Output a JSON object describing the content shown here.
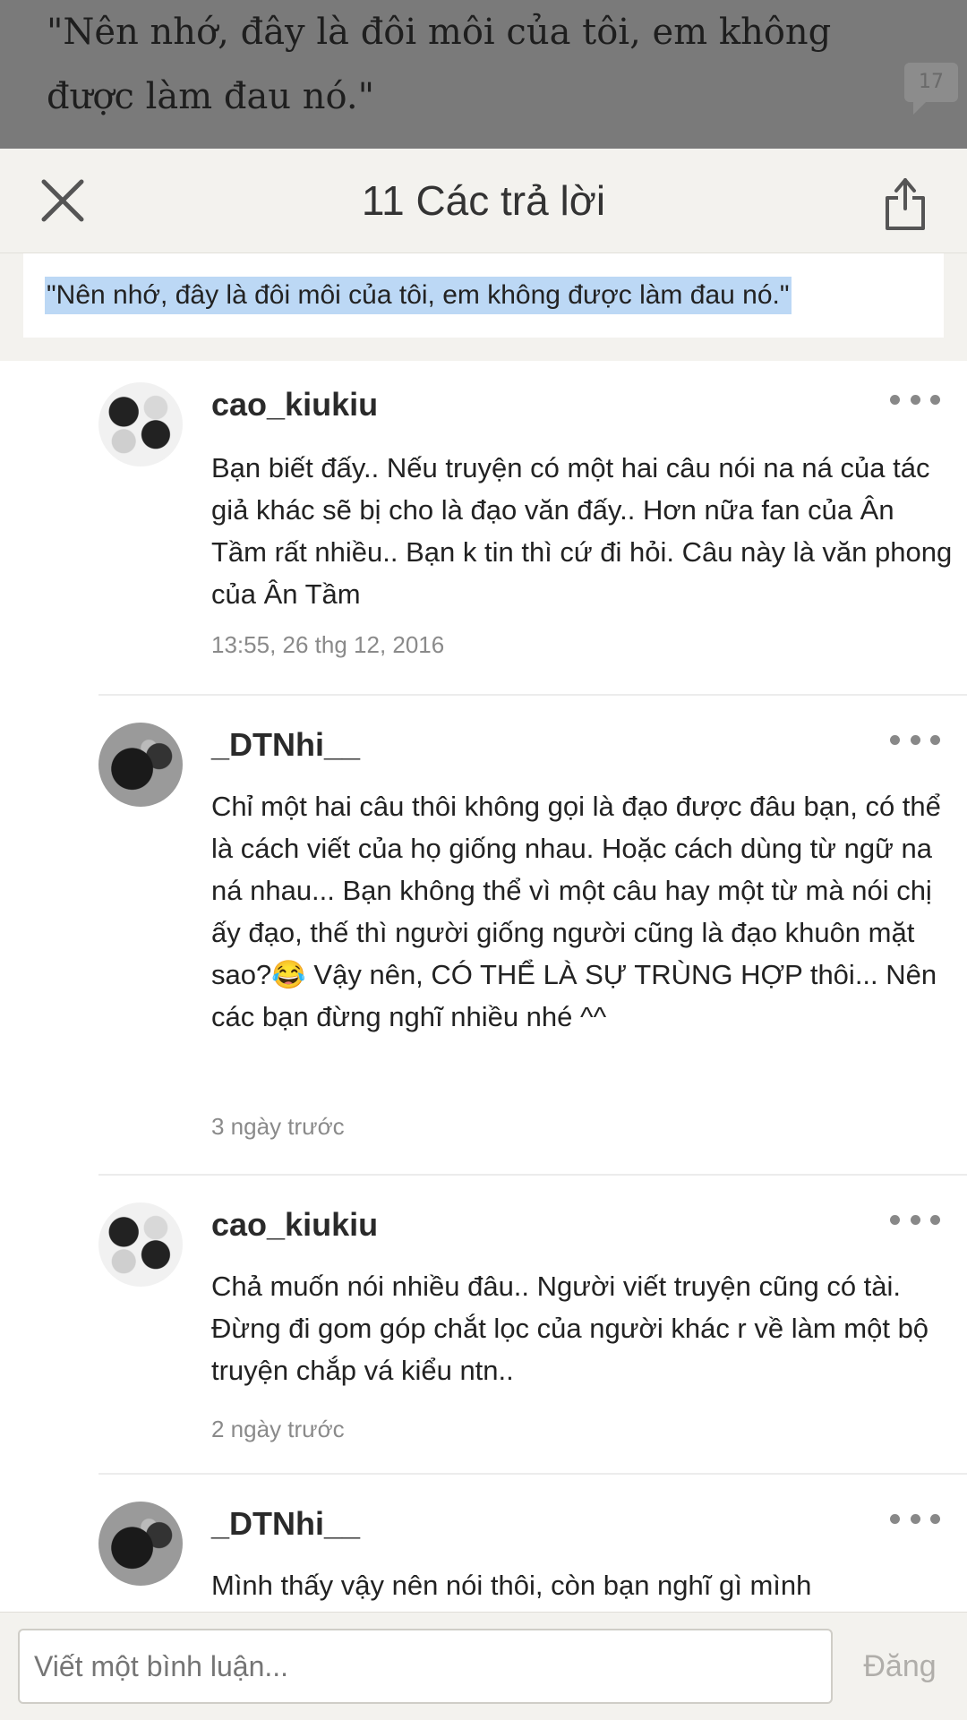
{
  "backdrop": {
    "story_text": "\"Nên nhớ, đây là đôi môi của tôi, em không được làm đau nó.\"",
    "comment_count_badge": "17"
  },
  "header": {
    "title": "11 Các trả lời",
    "close_icon": "close-icon",
    "share_icon": "share-icon"
  },
  "quote": {
    "text": "\"Nên nhớ, đây là đôi môi của tôi, em không được làm đau nó.\""
  },
  "comments": [
    {
      "username": "cao_kiukiu",
      "body": "Bạn biết đấy.. Nếu truyện có một hai câu nói na ná của tác giả khác sẽ bị cho là đạo văn đấy.. Hơn nữa fan của Ân Tầm rất nhiều.. Bạn k tin thì cứ đi hỏi. Câu này là văn phong của Ân Tầm",
      "time": "13:55, 26 thg 12, 2016"
    },
    {
      "username": "_DTNhi__",
      "body": "Chỉ một hai câu thôi không gọi là đạo được đâu bạn, có thể là cách viết của họ giống nhau. Hoặc cách dùng từ ngữ na ná nhau... Bạn không thể vì một câu hay một từ mà nói chị ấy đạo, thế thì người giống người cũng là đạo khuôn mặt sao?😂 Vậy nên, CÓ THỂ LÀ SỰ TRÙNG HỢP thôi... Nên các bạn đừng nghĩ nhiều nhé ^^",
      "time": "3 ngày trước"
    },
    {
      "username": "cao_kiukiu",
      "body": "Chả muốn nói nhiều đâu.. Người viết truyện cũng có tài.  Đừng đi gom góp chắt lọc của người khác r về làm một bộ truyện chắp vá kiểu ntn..",
      "time": "2 ngày trước"
    },
    {
      "username": "_DTNhi__",
      "body": "Mình thấy vậy nên nói thôi, còn bạn nghĩ gì mình",
      "time": ""
    }
  ],
  "footer": {
    "input_placeholder": "Viết một bình luận...",
    "post_label": "Đăng"
  },
  "colors": {
    "highlight": "#bcd8f5",
    "header_bg": "#f3f2ee",
    "backdrop": "#7a7a7a"
  }
}
